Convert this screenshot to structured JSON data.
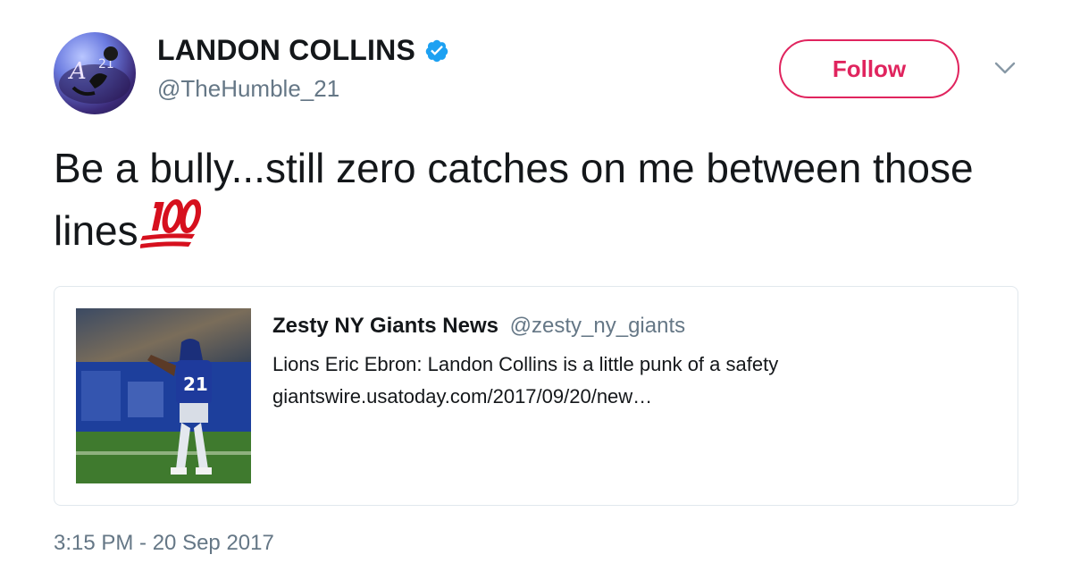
{
  "author": {
    "display_name": "LANDON COLLINS",
    "handle": "@TheHumble_21",
    "verified": true,
    "avatar_icon": "profile-avatar"
  },
  "actions": {
    "follow_label": "Follow",
    "more_icon": "chevron-down-icon"
  },
  "tweet": {
    "text": "Be a bully...still zero catches on me between those lines",
    "emoji": "hundred-points",
    "timestamp": "3:15 PM - 20 Sep 2017"
  },
  "quoted_card": {
    "title": "Zesty NY Giants News",
    "handle": "@zesty_ny_giants",
    "description": "Lions Eric Ebron: Landon Collins is a little punk of a safety",
    "url": "giantswire.usatoday.com/2017/09/20/new…",
    "image_icon": "football-player-photo"
  },
  "colors": {
    "follow_accent": "#e0245e",
    "verified_blue": "#1da1f2",
    "muted_text": "#657786",
    "emoji_red": "#d6101e"
  }
}
